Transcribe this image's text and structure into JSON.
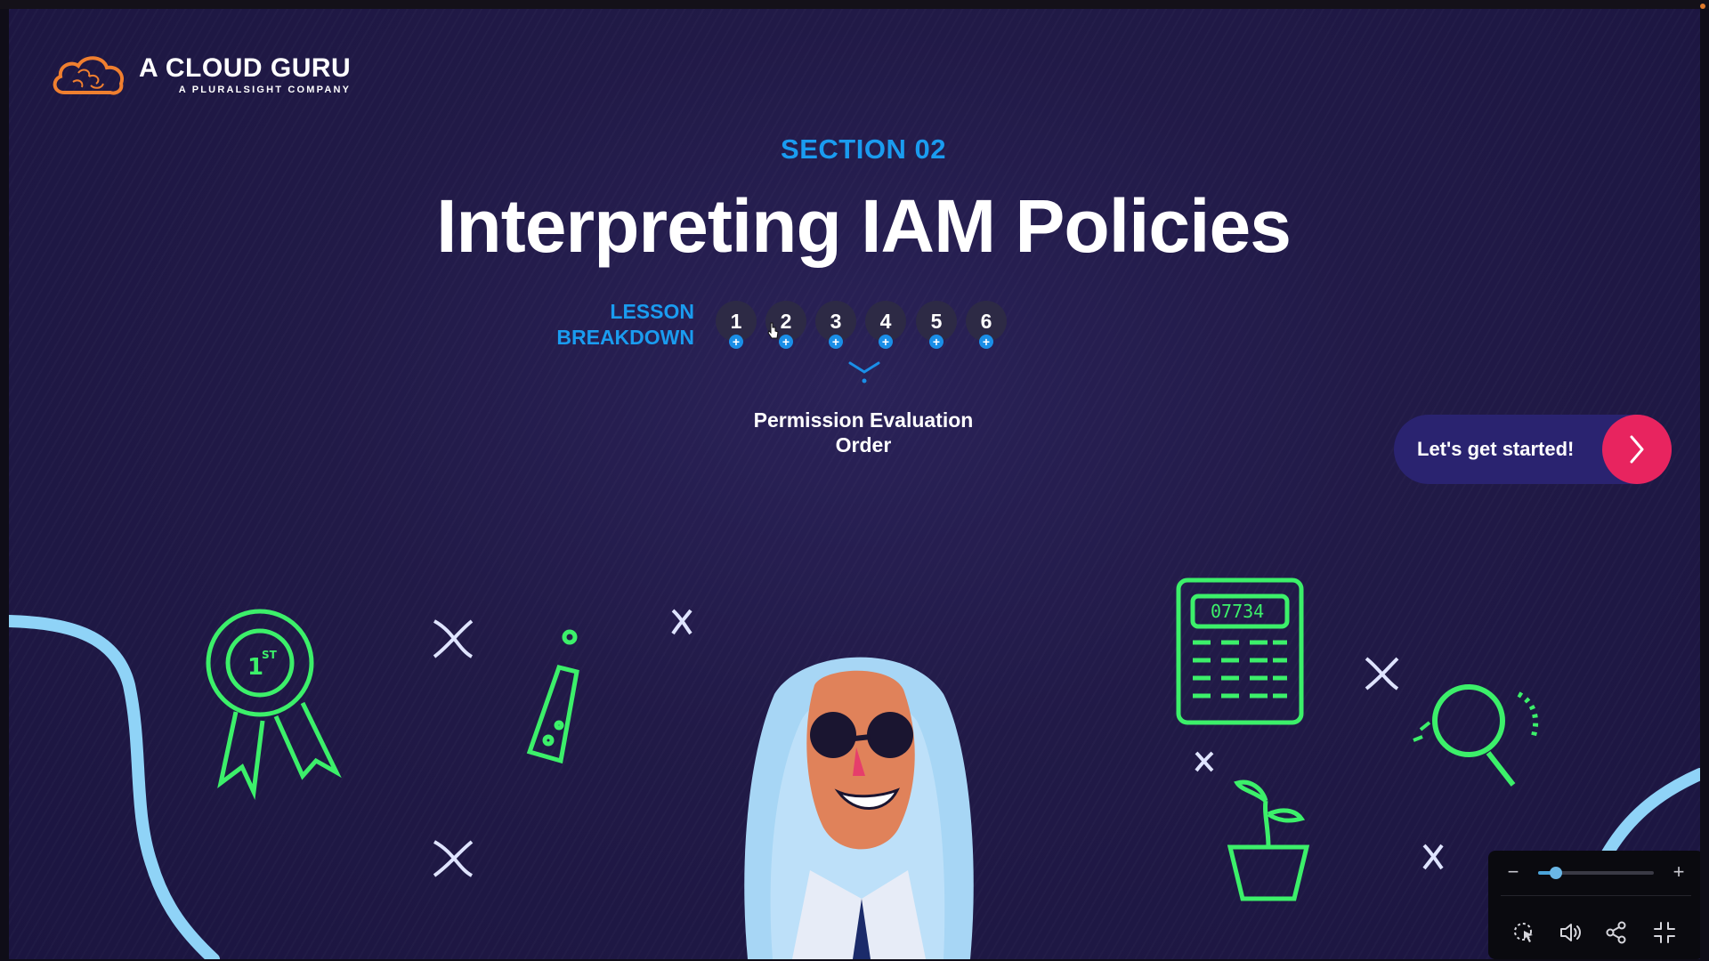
{
  "logo": {
    "name": "A CLOUD GURU",
    "subtitle": "A PLURALSIGHT COMPANY",
    "icon": "cloud-brain-icon"
  },
  "section": {
    "label": "SECTION 02",
    "title": "Interpreting IAM Policies"
  },
  "lesson_breakdown": {
    "label_line1": "LESSON",
    "label_line2": "BREAKDOWN",
    "lessons": [
      "1",
      "2",
      "3",
      "4",
      "5",
      "6"
    ],
    "selected_description_line1": "Permission Evaluation",
    "selected_description_line2": "Order"
  },
  "cta": {
    "label": "Let's get started!",
    "icon": "chevron-right-icon"
  },
  "player": {
    "zoom_minus": "−",
    "zoom_plus": "+",
    "zoom_level": 0.15,
    "controls": [
      "cursor-select-icon",
      "volume-icon",
      "share-icon",
      "exit-fullscreen-icon"
    ]
  },
  "colors": {
    "accent_blue": "#1a9cf0",
    "cta_pink": "#e8245f",
    "cta_bg": "#2a2370",
    "doodle_green": "#3cf06a",
    "wave_blue": "#8fd3f7"
  }
}
